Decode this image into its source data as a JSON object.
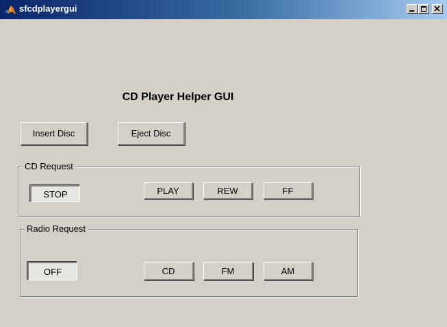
{
  "window": {
    "title": "sfcdplayergui"
  },
  "heading": "CD Player Helper GUI",
  "disc": {
    "insert_label": "Insert Disc",
    "eject_label": "Eject Disc"
  },
  "cd_request": {
    "label": "CD Request",
    "stop_label": "STOP",
    "play_label": "PLAY",
    "rew_label": "REW",
    "ff_label": "FF",
    "selected": "STOP"
  },
  "radio_request": {
    "label": "Radio Request",
    "off_label": "OFF",
    "cd_label": "CD",
    "fm_label": "FM",
    "am_label": "AM",
    "selected": "OFF"
  },
  "icons": {
    "app": "matlab-icon",
    "minimize": "minimize-icon",
    "maximize": "maximize-icon",
    "close": "close-icon"
  },
  "colors": {
    "face": "#d4d0c8",
    "titlebar_start": "#0a246a",
    "titlebar_end": "#a6caf0",
    "title_text": "#ffffff"
  }
}
